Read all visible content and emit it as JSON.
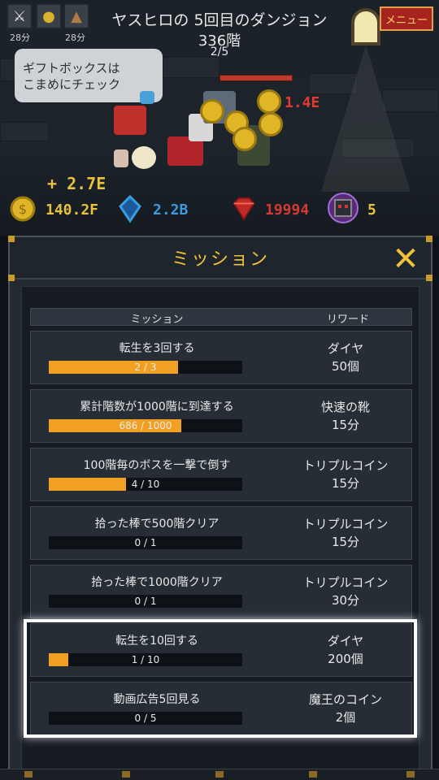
{
  "header": {
    "title": "ヤスヒロの 5回目のダンジョン",
    "floor": "336階",
    "wave": "2/5",
    "menu_label": "メニュー"
  },
  "buffs": [
    {
      "icon": "crossed-swords-icon",
      "time": "28分"
    },
    {
      "icon": "triple-coin-icon",
      "time": ""
    },
    {
      "icon": "speed-boots-icon",
      "time": "28分"
    }
  ],
  "tip_bubble": {
    "line1": "ギフトボックスは",
    "line2": "こまめにチェック"
  },
  "battle": {
    "damage": "1.4E"
  },
  "currency": {
    "gain": "+ 2.7E",
    "gold": "140.2F",
    "soul": "2.2B",
    "ruby": "19994",
    "demon_coin": "5",
    "colors": {
      "gold": "#e8c23a",
      "soul": "#3b9be0",
      "ruby": "#d43a32",
      "demon_coin": "#e8c23a"
    }
  },
  "panel": {
    "title": "ミッション",
    "col_mission": "ミッション",
    "col_reward": "リワード",
    "close_icon": "close-icon",
    "rows": [
      {
        "name": "転生を3回する",
        "progress_text": "2 / 3",
        "progress": 0.667,
        "reward_line1": "ダイヤ",
        "reward_line2": "50個"
      },
      {
        "name": "累計階数が1000階に到達する",
        "progress_text": "686 / 1000",
        "progress": 0.686,
        "reward_line1": "快速の靴",
        "reward_line2": "15分"
      },
      {
        "name": "100階毎のボスを一撃で倒す",
        "progress_text": "4 / 10",
        "progress": 0.4,
        "reward_line1": "トリプルコイン",
        "reward_line2": "15分"
      },
      {
        "name": "拾った棒で500階クリア",
        "progress_text": "0 / 1",
        "progress": 0.0,
        "reward_line1": "トリプルコイン",
        "reward_line2": "15分"
      },
      {
        "name": "拾った棒で1000階クリア",
        "progress_text": "0 / 1",
        "progress": 0.0,
        "reward_line1": "トリプルコイン",
        "reward_line2": "30分"
      },
      {
        "name": "転生を10回する",
        "progress_text": "1 / 10",
        "progress": 0.1,
        "reward_line1": "ダイヤ",
        "reward_line2": "200個"
      },
      {
        "name": "動画広告5回見る",
        "progress_text": "0 / 5",
        "progress": 0.0,
        "reward_line1": "魔王のコイン",
        "reward_line2": "2個"
      }
    ],
    "accent": "#f2a024"
  }
}
